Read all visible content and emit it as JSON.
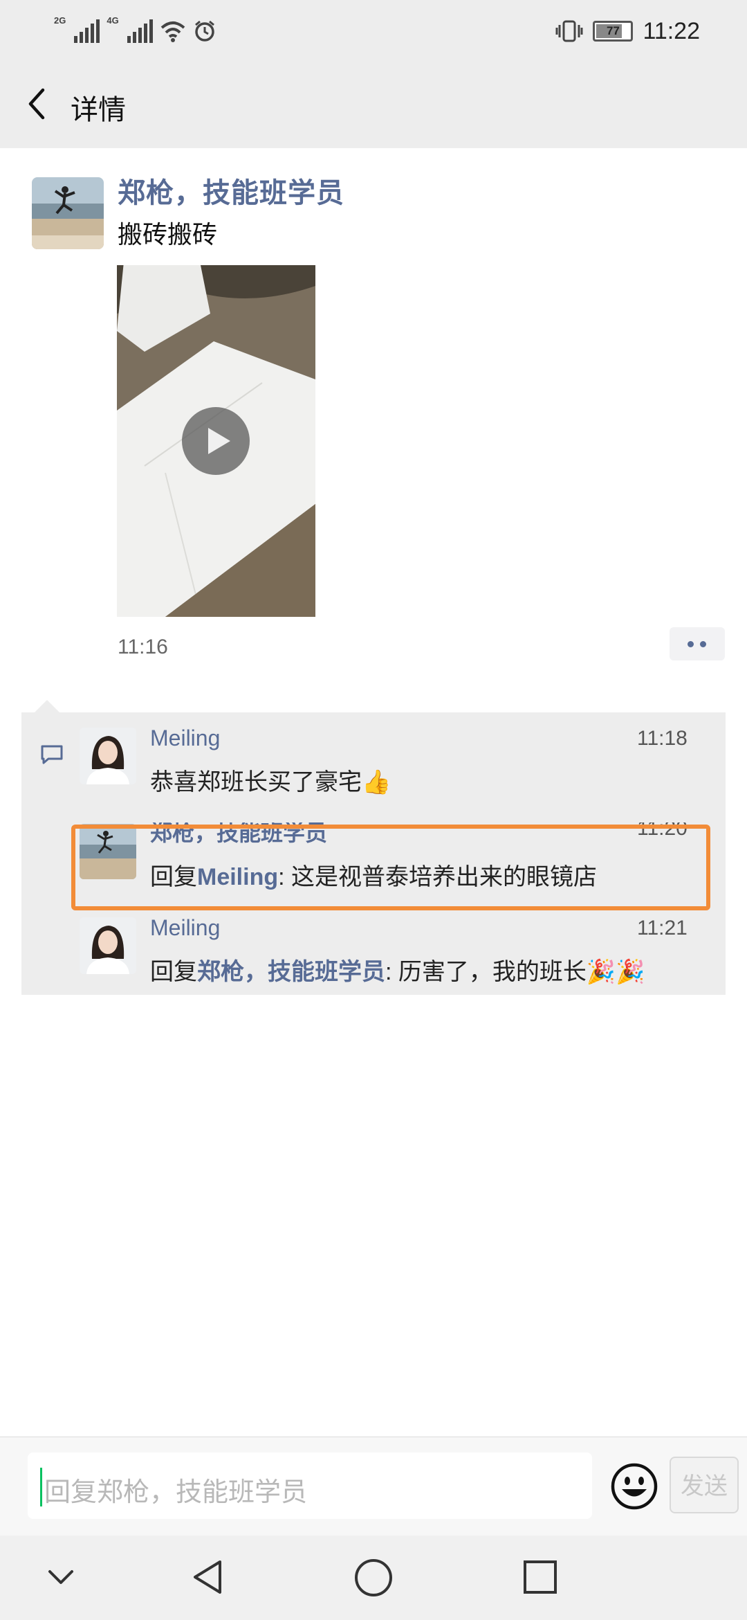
{
  "status_bar": {
    "sim1_label": "2G",
    "sim2_label": "4G",
    "battery": "77",
    "time": "11:22",
    "icons": [
      "signal-icon",
      "signal-icon",
      "wifi-icon",
      "alarm-icon",
      "vibrate-icon",
      "battery-icon"
    ]
  },
  "nav": {
    "title": "详情",
    "back_icon": "chevron-left-icon"
  },
  "post": {
    "author": "郑枪，技能班学员",
    "text": "搬砖搬砖",
    "time": "11:16",
    "video_icon": "play-icon",
    "more_icon": "more-dots-icon"
  },
  "comments": {
    "icon": "comment-icon",
    "items": [
      {
        "author": "Meiling",
        "time": "11:18",
        "text": "恭喜郑班长买了豪宅",
        "emoji": "👍"
      },
      {
        "author": "郑枪，技能班学员",
        "time": "11:20",
        "reply_prefix": "回复",
        "reply_to": "Meiling",
        "text": ": 这是视普泰培养出来的眼镜店"
      },
      {
        "author": "Meiling",
        "time": "11:21",
        "reply_prefix": "回复",
        "reply_to": "郑枪，技能班学员",
        "text": ": 历害了，我的班长",
        "emoji": "🎉🎉"
      }
    ]
  },
  "input": {
    "placeholder": "回复郑枪，技能班学员",
    "send_label": "发送",
    "emoji_icon": "smiley-icon"
  },
  "system_nav": {
    "icons": [
      "chevron-down-icon",
      "back-triangle-icon",
      "home-circle-icon",
      "recents-square-icon"
    ]
  },
  "colors": {
    "link": "#576b95",
    "bar_bg": "#ededed",
    "highlight": "#f28c38",
    "cursor": "#07c160"
  }
}
